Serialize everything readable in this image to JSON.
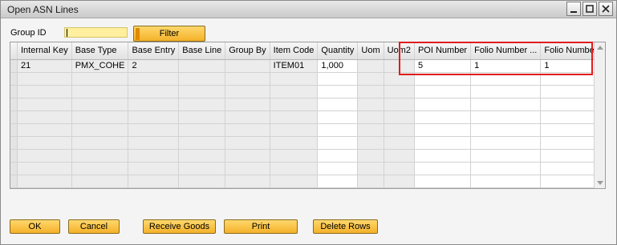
{
  "window": {
    "title": "Open ASN Lines",
    "controls": [
      "minimize-icon",
      "maximize-icon",
      "close-icon"
    ]
  },
  "filter": {
    "group_id_label": "Group ID",
    "group_id_value": "",
    "filter_button": "Filter"
  },
  "grid": {
    "columns": [
      "Internal Key",
      "Base Type",
      "Base Entry",
      "Base Line",
      "Group By",
      "Item Code",
      "Quantity",
      "Uom",
      "Uom2",
      "POI Number",
      "Folio Number ...",
      "Folio Numbe..."
    ],
    "rows": [
      [
        "21",
        "PMX_COHE",
        "2",
        "",
        "",
        "ITEM01",
        "1,000",
        "",
        "",
        "5",
        "1",
        "1"
      ]
    ],
    "empty_row_count": 9
  },
  "buttons": {
    "ok": "OK",
    "cancel": "Cancel",
    "receive_goods": "Receive Goods",
    "print": "Print",
    "delete_rows": "Delete Rows"
  },
  "colors": {
    "accent_button": "#f4b129",
    "input_highlight": "#ffef9e",
    "annotation_box": "#e11c1c"
  }
}
